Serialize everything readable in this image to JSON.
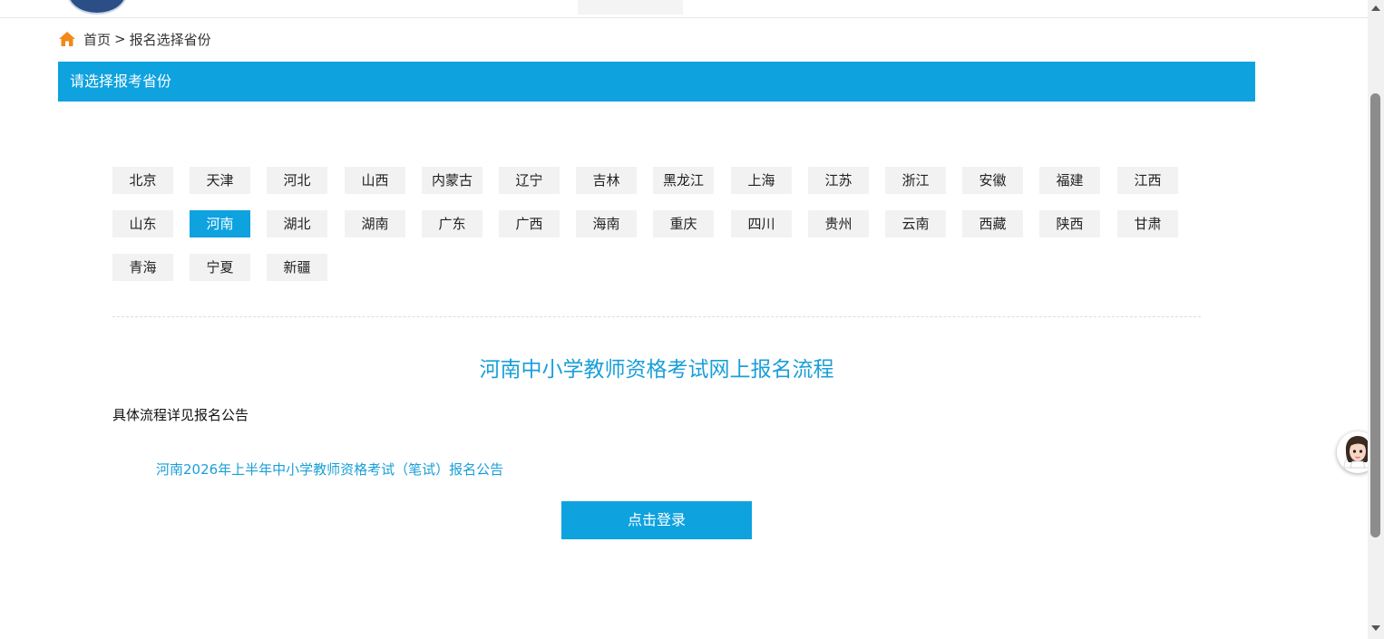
{
  "breadcrumb": {
    "home_label": "首页",
    "separator": ">",
    "current": "报名选择省份"
  },
  "title_bar": {
    "title": "请选择报考省份"
  },
  "provinces": [
    "北京",
    "天津",
    "河北",
    "山西",
    "内蒙古",
    "辽宁",
    "吉林",
    "黑龙江",
    "上海",
    "江苏",
    "浙江",
    "安徽",
    "福建",
    "江西",
    "山东",
    "河南",
    "湖北",
    "湖南",
    "广东",
    "广西",
    "海南",
    "重庆",
    "四川",
    "贵州",
    "云南",
    "西藏",
    "陕西",
    "甘肃",
    "青海",
    "宁夏",
    "新疆"
  ],
  "selected_province": "河南",
  "main": {
    "flow_title": "河南中小学教师资格考试网上报名流程",
    "detail_note": "具体流程详见报名公告",
    "announcement_link": "河南2026年上半年中小学教师资格考试（笔试）报名公告",
    "login_button": "点击登录"
  },
  "colors": {
    "accent": "#0ea2df",
    "link": "#1a9fd8",
    "province_bg": "#f2f2f2",
    "home_icon": "#f08a1c"
  },
  "icons": {
    "home": "home-icon",
    "assistant": "assistant-avatar-icon"
  }
}
